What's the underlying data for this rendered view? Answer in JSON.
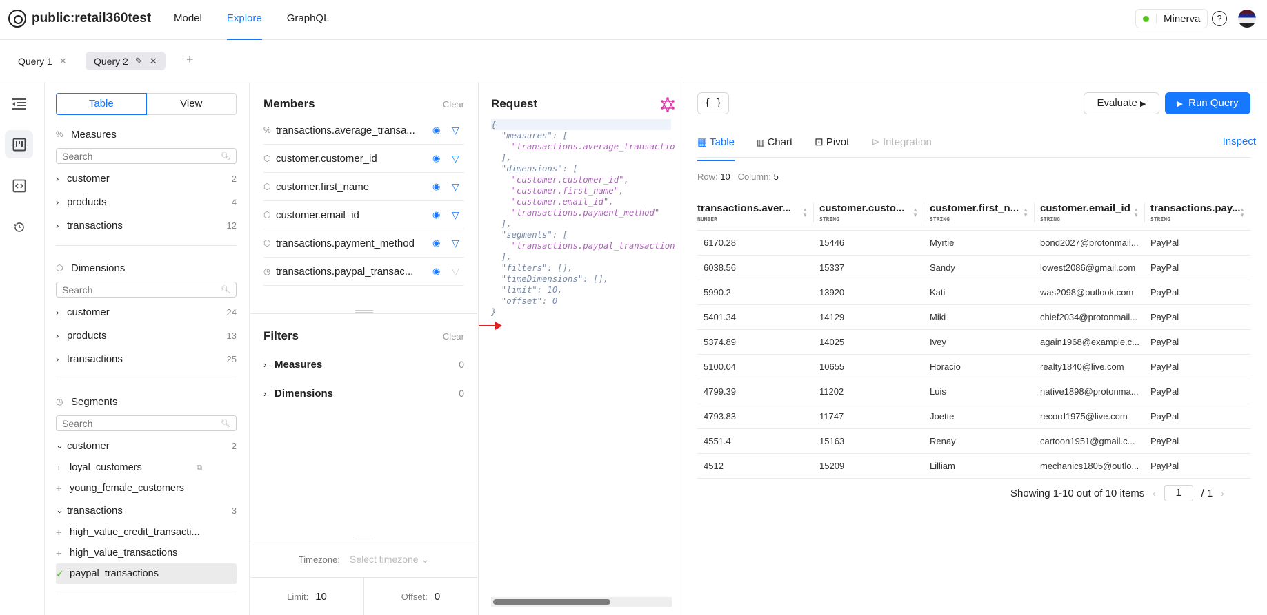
{
  "header": {
    "app_title": "public:retail360test",
    "nav": [
      {
        "label": "Model",
        "active": false
      },
      {
        "label": "Explore",
        "active": true
      },
      {
        "label": "GraphQL",
        "active": false
      }
    ],
    "status_label": "Minerva",
    "status_color": "#52c41a",
    "help_icon": "?"
  },
  "query_tabs": [
    {
      "label": "Query 1",
      "active": false
    },
    {
      "label": "Query 2",
      "active": true
    }
  ],
  "add_tab_label": "+",
  "left": {
    "toggle": [
      "Table",
      "View"
    ],
    "measures": {
      "title": "Measures",
      "search_placeholder": "Search",
      "groups": [
        {
          "label": "customer",
          "count": "2"
        },
        {
          "label": "products",
          "count": "4"
        },
        {
          "label": "transactions",
          "count": "12"
        }
      ]
    },
    "dimensions": {
      "title": "Dimensions",
      "search_placeholder": "Search",
      "groups": [
        {
          "label": "customer",
          "count": "24"
        },
        {
          "label": "products",
          "count": "13"
        },
        {
          "label": "transactions",
          "count": "25"
        }
      ]
    },
    "segments": {
      "title": "Segments",
      "search_placeholder": "Search",
      "groups": [
        {
          "label": "customer",
          "count": "2",
          "items": [
            {
              "label": "loyal_customers",
              "selected": false
            },
            {
              "label": "young_female_customers",
              "selected": false
            }
          ]
        },
        {
          "label": "transactions",
          "count": "3",
          "items": [
            {
              "label": "high_value_credit_transacti...",
              "selected": false
            },
            {
              "label": "high_value_transactions",
              "selected": false
            },
            {
              "label": "paypal_transactions",
              "selected": true
            }
          ]
        }
      ]
    }
  },
  "members": {
    "title": "Members",
    "clear_label": "Clear",
    "items": [
      {
        "label": "transactions.average_transa...",
        "type": "measure"
      },
      {
        "label": "customer.customer_id",
        "type": "dimension"
      },
      {
        "label": "customer.first_name",
        "type": "dimension"
      },
      {
        "label": "customer.email_id",
        "type": "dimension"
      },
      {
        "label": "transactions.payment_method",
        "type": "dimension"
      },
      {
        "label": "transactions.paypal_transac...",
        "type": "segment"
      }
    ]
  },
  "filters": {
    "title": "Filters",
    "clear_label": "Clear",
    "rows": [
      {
        "label": "Measures",
        "count": "0"
      },
      {
        "label": "Dimensions",
        "count": "0"
      }
    ]
  },
  "timezone": {
    "label": "Timezone:",
    "placeholder": "Select timezone"
  },
  "limit": {
    "label": "Limit:",
    "value": "10"
  },
  "offset": {
    "label": "Offset:",
    "value": "0"
  },
  "request": {
    "title": "Request",
    "lines": [
      "{",
      "  \"measures\": [",
      "    \"transactions.average_transactio",
      "  ],",
      "  \"dimensions\": [",
      "    \"customer.customer_id\",",
      "    \"customer.first_name\",",
      "    \"customer.email_id\",",
      "    \"transactions.payment_method\"",
      "  ],",
      "  \"segments\": [",
      "    \"transactions.paypal_transaction",
      "  ],",
      "  \"filters\": [],",
      "  \"timeDimensions\": [],",
      "  \"limit\": 10,",
      "  \"offset\": 0",
      "}"
    ]
  },
  "results": {
    "json_button": "{ }",
    "evaluate_label": "Evaluate",
    "run_label": "Run Query",
    "tabs": [
      {
        "label": "Table",
        "icon": "table-icon",
        "state": "active"
      },
      {
        "label": "Chart",
        "icon": "bar-chart-icon",
        "state": "normal"
      },
      {
        "label": "Pivot",
        "icon": "pivot-icon",
        "state": "normal"
      },
      {
        "label": "Integration",
        "icon": "terminal-icon",
        "state": "disabled"
      }
    ],
    "inspect_label": "Inspect",
    "row_label": "Row:",
    "row_count": "10",
    "column_label": "Column:",
    "column_count": "5",
    "columns": [
      {
        "name": "transactions.aver...",
        "type": "NUMBER"
      },
      {
        "name": "customer.custo...",
        "type": "STRING"
      },
      {
        "name": "customer.first_n...",
        "type": "STRING"
      },
      {
        "name": "customer.email_id",
        "type": "STRING"
      },
      {
        "name": "transactions.pay...",
        "type": "STRING"
      }
    ],
    "rows": [
      [
        "6170.28",
        "15446",
        "Myrtie",
        "bond2027@protonmail...",
        "PayPal"
      ],
      [
        "6038.56",
        "15337",
        "Sandy",
        "lowest2086@gmail.com",
        "PayPal"
      ],
      [
        "5990.2",
        "13920",
        "Kati",
        "was2098@outlook.com",
        "PayPal"
      ],
      [
        "5401.34",
        "14129",
        "Miki",
        "chief2034@protonmail...",
        "PayPal"
      ],
      [
        "5374.89",
        "14025",
        "Ivey",
        "again1968@example.c...",
        "PayPal"
      ],
      [
        "5100.04",
        "10655",
        "Horacio",
        "realty1840@live.com",
        "PayPal"
      ],
      [
        "4799.39",
        "11202",
        "Luis",
        "native1898@protonma...",
        "PayPal"
      ],
      [
        "4793.83",
        "11747",
        "Joette",
        "record1975@live.com",
        "PayPal"
      ],
      [
        "4551.4",
        "15163",
        "Renay",
        "cartoon1951@gmail.c...",
        "PayPal"
      ],
      [
        "4512",
        "15209",
        "Lilliam",
        "mechanics1805@outlo...",
        "PayPal"
      ]
    ],
    "pagination": {
      "summary": "Showing 1-10 out of 10 items",
      "current_page": "1",
      "total_pages": "/  1"
    }
  }
}
